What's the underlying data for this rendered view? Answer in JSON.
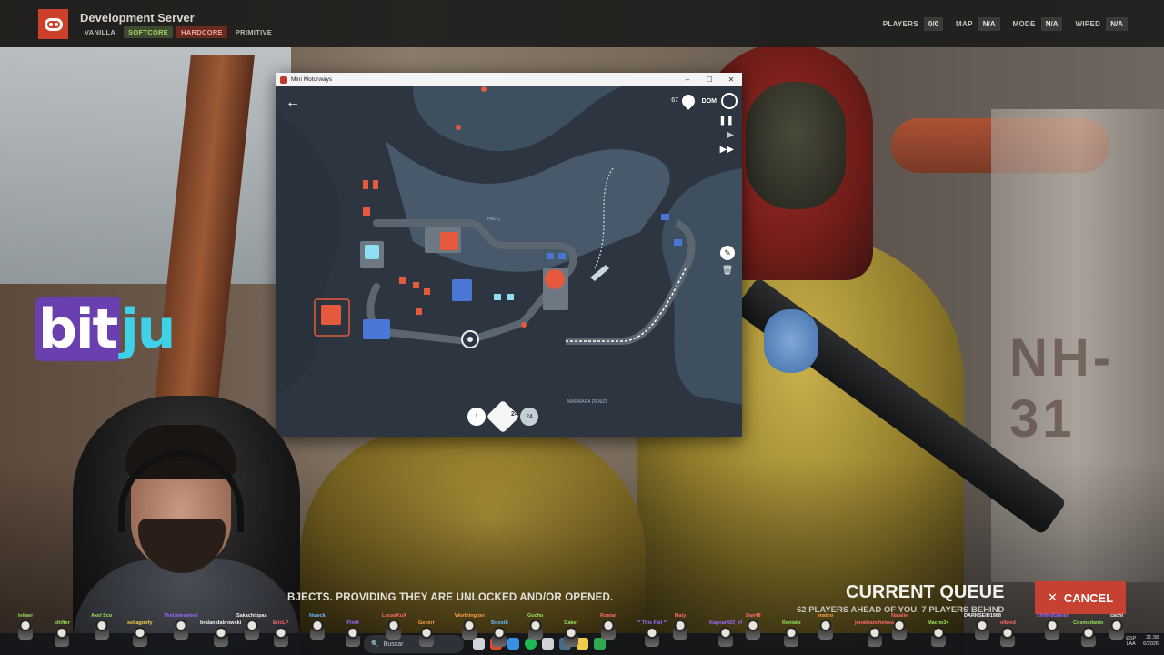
{
  "server": {
    "title": "Development Server",
    "tags": [
      "VANILLA",
      "SOFTCORE",
      "HARDCORE",
      "PRIMITIVE"
    ]
  },
  "stats": [
    {
      "label": "PLAYERS",
      "value": "0/0"
    },
    {
      "label": "MAP",
      "value": "N/A"
    },
    {
      "label": "MODE",
      "value": "N/A"
    },
    {
      "label": "WIPED",
      "value": "N/A"
    }
  ],
  "game_window": {
    "title": "Mini Motorways",
    "score": "67",
    "day": "DOM",
    "river_label_1": "HALIÇ",
    "river_label_2": "MARMARA DENIZI",
    "road_count": "24",
    "tool_left_count": "1",
    "tool_right_count": "24",
    "controls": [
      "minimize",
      "maximize",
      "close"
    ]
  },
  "branding": {
    "left": "bit",
    "right": "ju"
  },
  "ticker": "BJECTS. PROVIDING THEY ARE UNLOCKED AND/OR OPENED.",
  "queue": {
    "title": "CURRENT QUEUE",
    "subtitle": "62 PLAYERS AHEAD OF YOU, 7 PLAYERS BEHIND",
    "cancel_label": "CANCEL"
  },
  "taskbar": {
    "search_placeholder": "Buscar",
    "lang_line1": "ESP",
    "lang_line2": "LAA",
    "time": "21:38",
    "date": "6/2026"
  },
  "chat_users": [
    {
      "name": "ivitaer",
      "color": "#9be15d"
    },
    {
      "name": "shifter",
      "color": "#9be15d"
    },
    {
      "name": "Axel Sco",
      "color": "#9be15d"
    },
    {
      "name": "sebagoofy",
      "color": "#f2d04b"
    },
    {
      "name": "TheUnleashed",
      "color": "#9a6bff"
    },
    {
      "name": "bralan dabrowski",
      "color": "#f2f2f2"
    },
    {
      "name": "Sakachiopas",
      "color": "#f2f2f2"
    },
    {
      "name": "EricLP",
      "color": "#ff6b6b"
    },
    {
      "name": "Nowck",
      "color": "#6bb8ff"
    },
    {
      "name": "Pint4",
      "color": "#9a6bff"
    },
    {
      "name": "LucasKuX",
      "color": "#ff6b6b"
    },
    {
      "name": "Gecerr",
      "color": "#ff9e4a"
    },
    {
      "name": "Worthington",
      "color": "#ff9e4a"
    },
    {
      "name": "Boost8",
      "color": "#6bb8ff"
    },
    {
      "name": "Gucho",
      "color": "#9be15d"
    },
    {
      "name": "Daker",
      "color": "#9be15d"
    },
    {
      "name": "Rostar",
      "color": "#ff6b6b"
    },
    {
      "name": "** This Fail **",
      "color": "#9a6bff"
    },
    {
      "name": "Maty",
      "color": "#ff6b6b"
    },
    {
      "name": "Ragnar420_ef",
      "color": "#9a6bff"
    },
    {
      "name": "Dan48",
      "color": "#ff6b6b"
    },
    {
      "name": "Reniakz",
      "color": "#9be15d"
    },
    {
      "name": "mateo",
      "color": "#ff9e4a"
    },
    {
      "name": "jonathanchelsea",
      "color": "#ff6b6b"
    },
    {
      "name": "Natalie",
      "color": "#ff6b6b"
    },
    {
      "name": "Macho34",
      "color": "#9be15d"
    },
    {
      "name": "DARKSEID1988",
      "color": "#f2f2f2"
    },
    {
      "name": "olbred",
      "color": "#ff6b6b"
    },
    {
      "name": "ShiftedGhost",
      "color": "#9a6bff"
    },
    {
      "name": "Cosmodanio",
      "color": "#9be15d"
    },
    {
      "name": "cachi",
      "color": "#f2f2f2"
    }
  ]
}
